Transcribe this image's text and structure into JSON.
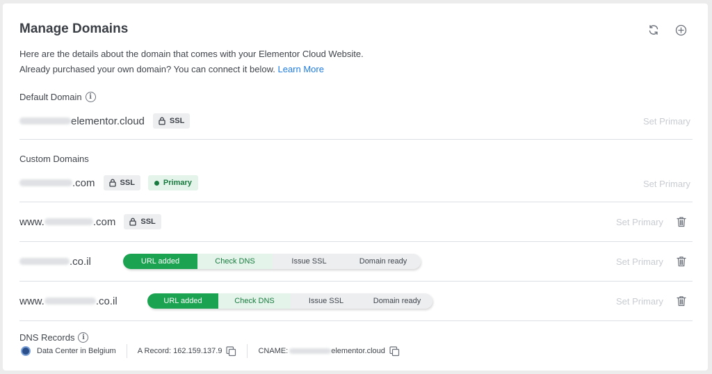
{
  "header": {
    "title": "Manage Domains",
    "refresh_icon": "refresh-icon",
    "add_icon": "plus-circle-icon"
  },
  "description": {
    "line1": "Here are the details about the domain that comes with your Elementor Cloud Website.",
    "line2": "Already purchased your own domain? You can connect it below.",
    "learn_more": "Learn More"
  },
  "default_domain": {
    "label": "Default Domain",
    "suffix": "elementor.cloud",
    "ssl": "SSL",
    "set_primary": "Set Primary"
  },
  "custom_domains": {
    "label": "Custom Domains",
    "rows": [
      {
        "prefix": "",
        "suffix": ".com",
        "ssl": "SSL",
        "status": "Primary",
        "set_primary": "Set Primary"
      },
      {
        "prefix": "www.",
        "suffix": ".com",
        "ssl": "SSL",
        "set_primary": "Set Primary"
      },
      {
        "prefix": "",
        "suffix": ".co.il",
        "set_primary": "Set Primary"
      },
      {
        "prefix": "www.",
        "suffix": ".co.il",
        "set_primary": "Set Primary"
      }
    ]
  },
  "progress_steps": [
    "URL added",
    "Check DNS",
    "Issue SSL",
    "Domain ready"
  ],
  "dns_records": {
    "label": "DNS Records",
    "data_center": "Data Center in Belgium",
    "a_record": "A Record: 162.159.137.9",
    "cname_label": "CNAME:",
    "cname_suffix": "elementor.cloud"
  },
  "colors": {
    "accent_green": "#1ba351",
    "light_green": "#e4f4ea",
    "link_blue": "#1f7ce0",
    "muted": "#c8ccd1"
  }
}
